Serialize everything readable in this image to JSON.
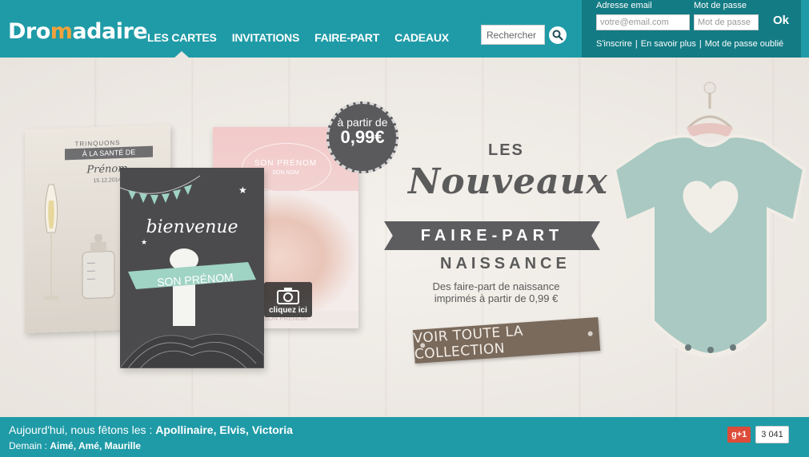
{
  "header": {
    "logo_start": "Dro",
    "logo_accent": "m",
    "logo_end": "adaire",
    "nav": [
      "Les cartes",
      "Invitations",
      "Faire-part",
      "Cadeaux"
    ],
    "active_nav": "Les cartes",
    "search_placeholder": "Rechercher"
  },
  "login": {
    "email_label": "Adresse email",
    "email_placeholder": "votre@email.com",
    "password_label": "Mot de passe",
    "password_placeholder": "Mot de passe",
    "ok_label": "Ok",
    "links": [
      "S'inscrire",
      "En savoir plus",
      "Mot de passe oublié"
    ]
  },
  "hero": {
    "badge_line1": "à partir de",
    "badge_price": "0,99€",
    "camera_label": "cliquez ici",
    "headline_les": "LES",
    "headline_nouveaux": "Nouveaux",
    "headline_faire_part": "FAIRE-PART",
    "headline_naissance": "NAISSANCE",
    "subtitle": "Des faire-part de naissance imprimés à partir de 0,99 €",
    "cta": "VOIR TOUTE LA COLLECTION",
    "card_champagne_line1": "TRINQUONS",
    "card_champagne_line2": "À LA SANTÉ DE",
    "card_champagne_name": "Prénom",
    "card_champagne_date": "15.12.2014",
    "card_photo_name": "SON PRÉNOM",
    "card_photo_sub": "SON NOM",
    "card_photo_bottom": "SON PRÉNOM",
    "card_bienvenue_title": "bienvenue",
    "card_bienvenue_name": "SON PRÉNOM"
  },
  "footer": {
    "today_label": "Aujourd'hui, nous fêtons les :",
    "today_names": "Apollinaire, Elvis, Victoria",
    "tomorrow_label": "Demain :",
    "tomorrow_names": "Aimé, Amé, Maurille",
    "gplus_label": "g+1",
    "gplus_count": "3 041"
  },
  "colors": {
    "header": "#1f9ba7",
    "login_panel": "#137b84",
    "accent_logo": "#f2a13b"
  }
}
